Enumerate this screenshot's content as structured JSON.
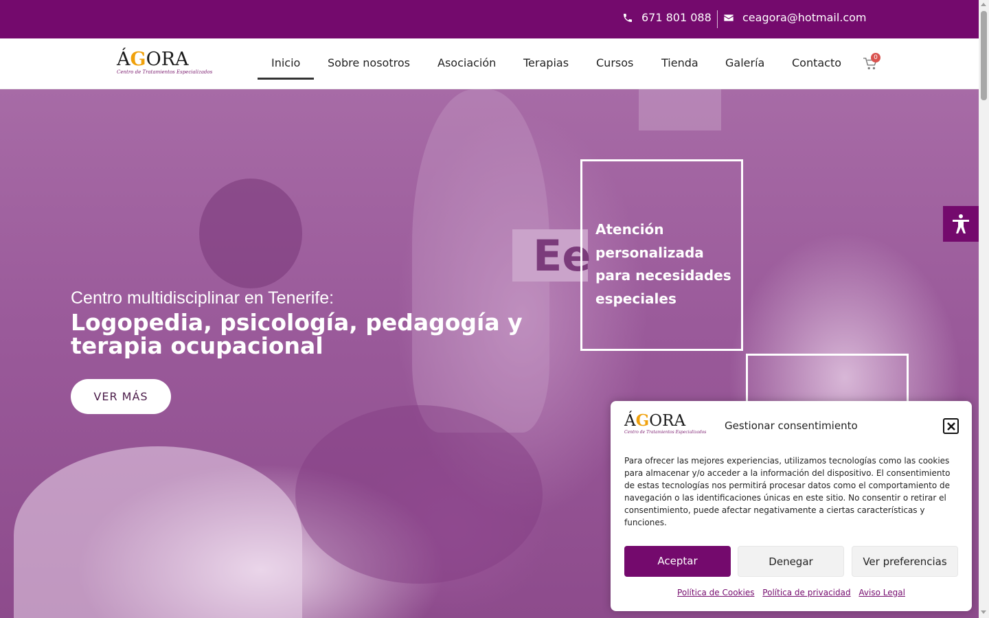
{
  "topbar": {
    "phone": "671 801 088",
    "email": "ceagora@hotmail.com",
    "phone_icon": "phone-icon",
    "email_icon": "envelope-icon"
  },
  "logo": {
    "word_pre": "Á",
    "word_g": "G",
    "word_post": "ORA",
    "tagline": "Centro de Tratamientos Especializados"
  },
  "nav": {
    "items": [
      {
        "label": "Inicio",
        "active": true
      },
      {
        "label": "Sobre nosotros"
      },
      {
        "label": "Asociación"
      },
      {
        "label": "Terapias"
      },
      {
        "label": "Cursos"
      },
      {
        "label": "Tienda"
      },
      {
        "label": "Galería"
      },
      {
        "label": "Contacto"
      }
    ],
    "cart_icon": "cart-icon",
    "cart_count": "0"
  },
  "hero": {
    "subtitle": "Centro multidisciplinar en Tenerife:",
    "title": "Logopedia, psicología, pedagogía y terapia ocupacional",
    "button": "VER MÁS",
    "card_letters": "Ee",
    "box_text": "Atención personalizada para necesidades especiales"
  },
  "accessibility": {
    "icon": "accessibility-icon"
  },
  "consent": {
    "title": "Gestionar consentimiento",
    "text": "Para ofrecer las mejores experiencias, utilizamos tecnologías como las cookies para almacenar y/o acceder a la información del dispositivo. El consentimiento de estas tecnologías nos permitirá procesar datos como el comportamiento de navegación o las identificaciones únicas en este sitio. No consentir o retirar el consentimiento, puede afectar negativamente a ciertas características y funciones.",
    "accept": "Aceptar",
    "deny": "Denegar",
    "preferences": "Ver preferencias",
    "links": [
      "Política de Cookies",
      "Política de privacidad",
      "Aviso Legal"
    ],
    "close_icon": "close-icon"
  },
  "colors": {
    "brand": "#740a6d",
    "logo_accent": "#f0a10c",
    "badge": "#d9534f"
  }
}
